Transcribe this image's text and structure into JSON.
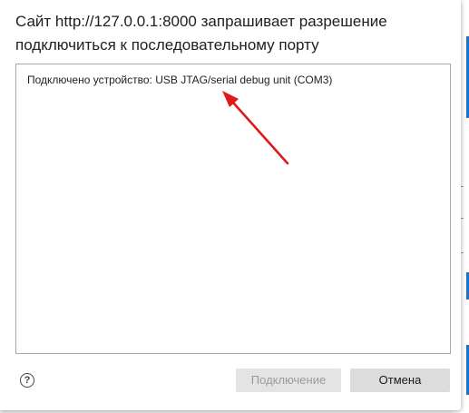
{
  "dialog": {
    "title_line1": "Сайт http://127.0.0.1:8000 запрашивает разрешение",
    "title_line2": "подключиться к последовательному порту",
    "devices": [
      {
        "label": "Подключено устройство: USB JTAG/serial debug unit (COM3)"
      }
    ],
    "help_icon": "?",
    "connect_label": "Подключение",
    "cancel_label": "Отмена"
  },
  "annotation": {
    "arrow_color": "#e0191b"
  },
  "colors": {
    "list_border": "#a8a8a8",
    "disabled_button_bg": "#e4e4e4",
    "disabled_button_text": "#9b9b9b",
    "cancel_button_bg": "#dcdcdc",
    "background_accent": "#1a73c8"
  }
}
